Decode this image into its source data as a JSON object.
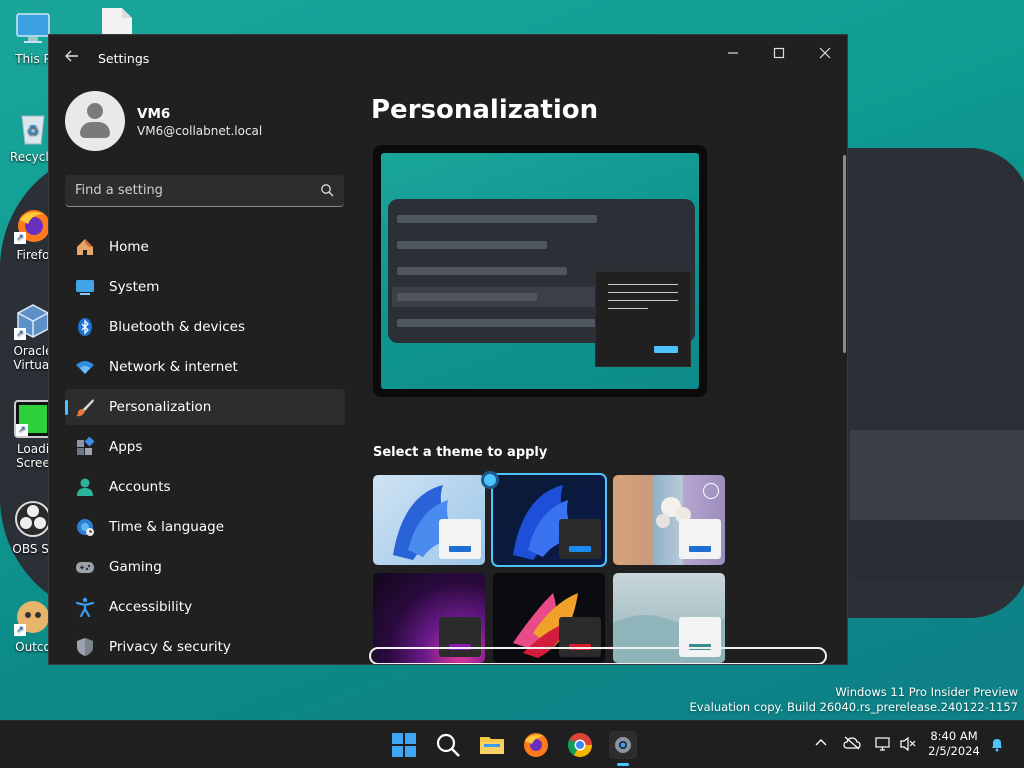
{
  "desktop": {
    "icons": [
      {
        "label": "This P"
      },
      {
        "label": "Recycle"
      },
      {
        "label": "Firefo"
      },
      {
        "label": "Oracle\nVirtual"
      },
      {
        "label": "Loadi\nScree"
      },
      {
        "label": "OBS St"
      },
      {
        "label": "Outco"
      }
    ]
  },
  "window": {
    "title": "Settings",
    "back_icon": "back-arrow-icon",
    "controls": {
      "minimize": "─",
      "maximize": "☐",
      "close": "✕"
    }
  },
  "profile": {
    "name": "VM6",
    "email": "VM6@collabnet.local"
  },
  "search": {
    "placeholder": "Find a setting",
    "value": ""
  },
  "nav": {
    "items": [
      {
        "label": "Home",
        "icon": "home-icon"
      },
      {
        "label": "System",
        "icon": "monitor-icon"
      },
      {
        "label": "Bluetooth & devices",
        "icon": "bluetooth-icon"
      },
      {
        "label": "Network & internet",
        "icon": "wifi-icon"
      },
      {
        "label": "Personalization",
        "icon": "paintbrush-icon",
        "active": true
      },
      {
        "label": "Apps",
        "icon": "apps-icon"
      },
      {
        "label": "Accounts",
        "icon": "person-icon"
      },
      {
        "label": "Time & language",
        "icon": "globe-clock-icon"
      },
      {
        "label": "Gaming",
        "icon": "gamepad-icon"
      },
      {
        "label": "Accessibility",
        "icon": "accessibility-icon"
      },
      {
        "label": "Privacy & security",
        "icon": "shield-icon"
      }
    ]
  },
  "main": {
    "title": "Personalization",
    "section_title": "Select a theme to apply",
    "themes": [
      {
        "name": "windows-light",
        "selected": false
      },
      {
        "name": "windows-dark",
        "selected": true
      },
      {
        "name": "spotlight",
        "selected": false
      },
      {
        "name": "glow",
        "selected": false
      },
      {
        "name": "captured-motion",
        "selected": false
      },
      {
        "name": "flow",
        "selected": false
      }
    ]
  },
  "watermark": {
    "line1": "Windows 11 Pro Insider Preview",
    "line2": "Evaluation copy. Build 26040.rs_prerelease.240122-1157"
  },
  "taskbar": {
    "apps": [
      "start-icon",
      "search-icon",
      "file-explorer-icon",
      "firefox-icon",
      "chrome-icon",
      "settings-icon"
    ]
  },
  "clock": {
    "time": "8:40 AM",
    "date": "2/5/2024"
  },
  "colors": {
    "accent": "#4cc2ff",
    "window_bg": "#202020",
    "nav_active_bg": "#2d2d2d"
  }
}
